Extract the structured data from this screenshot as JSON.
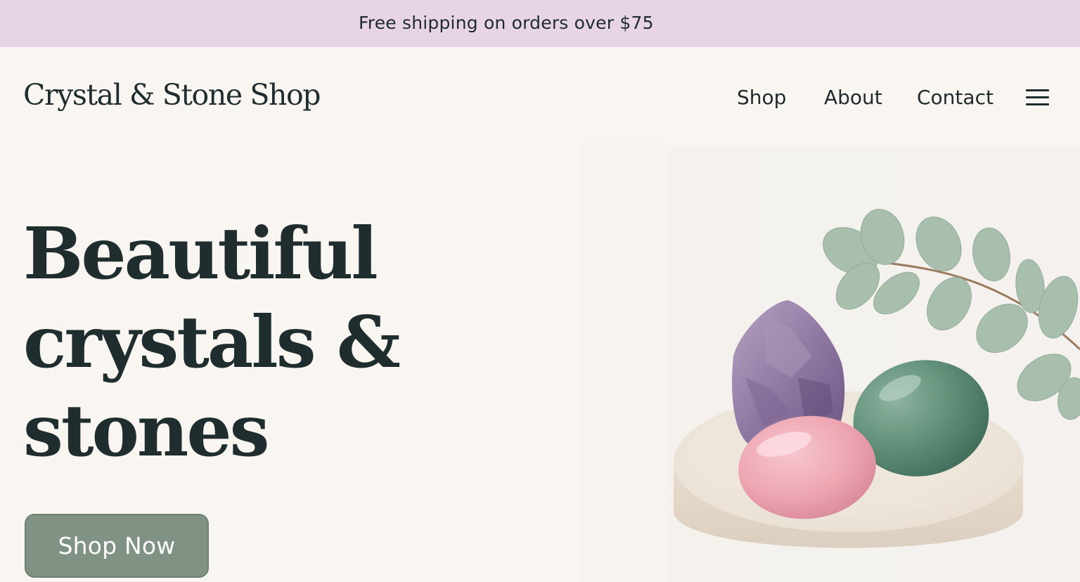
{
  "promo": {
    "text": "Free shipping on orders over $75"
  },
  "header": {
    "logo": "Crystal & Stone Shop",
    "nav": [
      {
        "label": "Shop"
      },
      {
        "label": "About"
      },
      {
        "label": "Contact"
      }
    ],
    "menu_icon": "hamburger-menu-icon"
  },
  "hero": {
    "title_lines": [
      "Beautiful",
      "crystals &",
      "stones"
    ],
    "cta_label": "Shop Now",
    "image": "amethyst-rose-quartz-aventurine-on-ceramic-dish-with-eucalyptus"
  },
  "colors": {
    "promo_background": "#e7d5e6",
    "page_background": "#f9f6f2",
    "text_dark": "#1f2d2f",
    "cta_background": "#7f9283"
  }
}
